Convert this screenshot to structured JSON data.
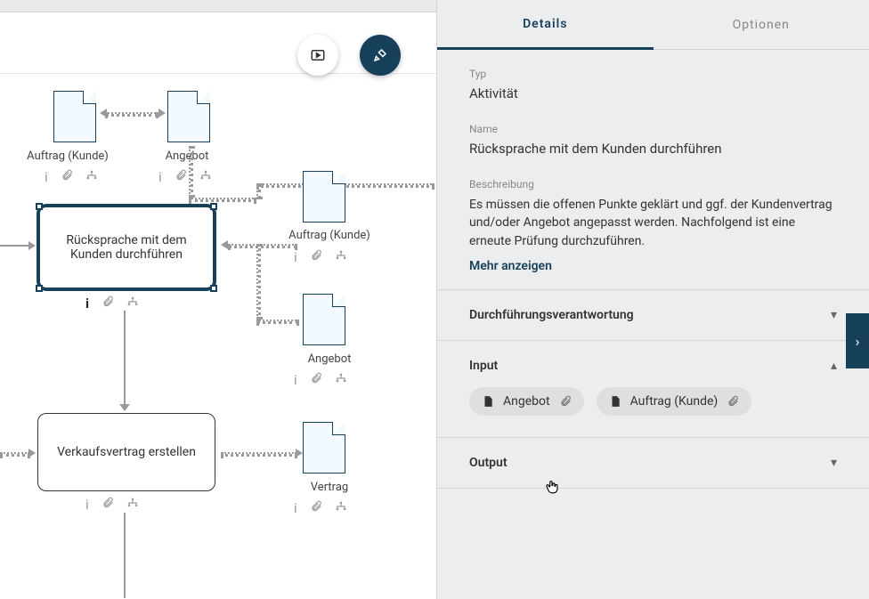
{
  "tabs": {
    "details": "Details",
    "options": "Optionen"
  },
  "typ_label": "Typ",
  "typ_value": "Aktivität",
  "name_label": "Name",
  "name_value": "Rücksprache mit dem Kunden durchführen",
  "desc_label": "Beschreibung",
  "desc_value": "Es müssen die offenen Punkte geklärt und ggf. der Kundenvertrag und/oder Angebot angepasst werden. Nachfolgend ist eine erneute Prüfung durchzuführen.",
  "show_more": "Mehr anzeigen",
  "sections": {
    "responsibility": "Durchführungsverantwortung",
    "input": "Input",
    "output": "Output"
  },
  "input_chips": [
    "Angebot",
    "Auftrag (Kunde)"
  ],
  "diagram": {
    "doc_auftrag_top": "Auftrag (Kunde)",
    "doc_angebot_top": "Angebot",
    "doc_auftrag_side": "Auftrag (Kunde)",
    "doc_angebot_side": "Angebot",
    "doc_vertrag": "Vertrag",
    "activity_selected": "Rücksprache mit dem Kunden durchführen",
    "activity_next": "Verkaufsvertrag erstellen"
  }
}
